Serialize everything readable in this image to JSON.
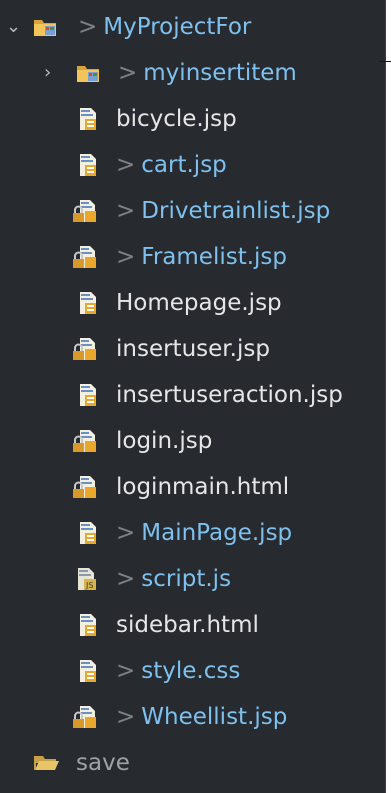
{
  "tree": {
    "project": {
      "label": "MyProjectFor",
      "expanded": true,
      "modified": true
    },
    "items": [
      {
        "label": "myinsertitem",
        "type": "package",
        "modified": true,
        "expandable": true
      },
      {
        "label": "bicycle.jsp",
        "type": "jsp",
        "modified": false
      },
      {
        "label": "cart.jsp",
        "type": "jsp",
        "modified": true
      },
      {
        "label": "Drivetrainlist.jsp",
        "type": "jsp-locked",
        "modified": true
      },
      {
        "label": "Framelist.jsp",
        "type": "jsp-locked",
        "modified": true
      },
      {
        "label": "Homepage.jsp",
        "type": "jsp",
        "modified": false
      },
      {
        "label": "insertuser.jsp",
        "type": "jsp-locked",
        "modified": false
      },
      {
        "label": "insertuseraction.jsp",
        "type": "jsp",
        "modified": false
      },
      {
        "label": "login.jsp",
        "type": "jsp-locked",
        "modified": false
      },
      {
        "label": "loginmain.html",
        "type": "html-locked",
        "modified": false
      },
      {
        "label": "MainPage.jsp",
        "type": "jsp",
        "modified": true
      },
      {
        "label": "script.js",
        "type": "js",
        "modified": true
      },
      {
        "label": "sidebar.html",
        "type": "html",
        "modified": false
      },
      {
        "label": "style.css",
        "type": "css",
        "modified": true
      },
      {
        "label": "Wheellist.jsp",
        "type": "jsp-locked",
        "modified": true
      }
    ],
    "save_folder": {
      "label": "save"
    },
    "modified_marker": ">"
  },
  "colors": {
    "background": "#272a2e",
    "modified_text": "#7ec0ee",
    "normal_text": "#e6e6e6",
    "dim_text": "#9ea2a7"
  }
}
